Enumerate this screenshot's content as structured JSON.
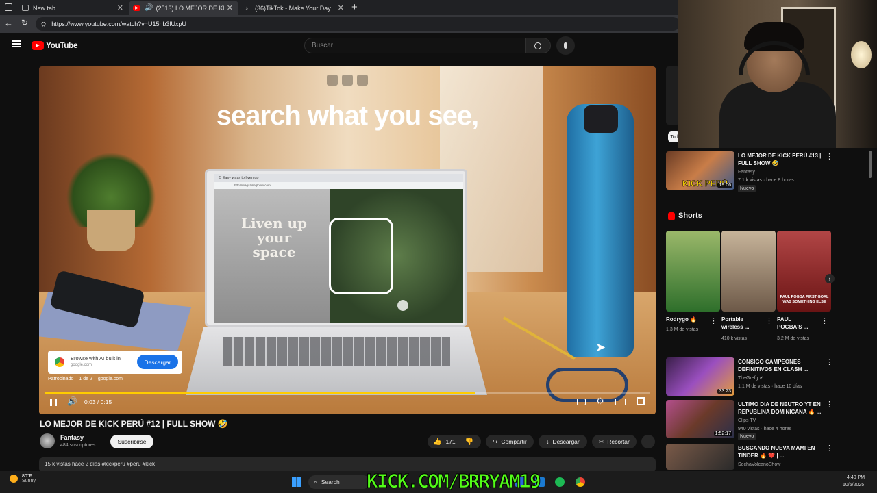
{
  "browser": {
    "tabs": [
      {
        "title": "New tab"
      },
      {
        "title": "(2513) LO MEJOR DE KICK PE"
      },
      {
        "title": "(36)TikTok - Make Your Day"
      }
    ],
    "url": "https://www.youtube.com/watch?v=U15hb3lUxpU"
  },
  "youtube": {
    "logo_text": "YouTube",
    "search_placeholder": "Buscar"
  },
  "video": {
    "headline": "search what you see,",
    "laptop_tab": "5 Easy ways to liven up",
    "laptop_url": "http://magazinegloom.com",
    "laptop_text": "Liven up your space",
    "ad": {
      "text": "Browse with AI built in",
      "domain": "google.com",
      "button": "Descargar",
      "sponsor_line": "Patrocinado",
      "sponsor_count": "1 de 2",
      "sponsor_domain": "google.com"
    },
    "time": "0:03 / 0:15",
    "progress": 0.71
  },
  "meta": {
    "title": "LO MEJOR DE KICK PERÚ #12 | FULL SHOW 🤣",
    "channel": "Fantasy",
    "subscribers": "484 suscriptores",
    "subscribe": "Suscribirse",
    "likes": "171",
    "share": "Compartir",
    "download": "Descargar",
    "clip": "Recortar",
    "description": "15 k vistas  hace 2 días  #kickperu #peru #kick"
  },
  "sidebar": {
    "chip": "Tod",
    "video1": {
      "title": "LO MEJOR DE KICK PERÚ #13 | FULL SHOW 🤣",
      "channel": "Fantasy",
      "stats": "7.1 k vistas · hace 8 horas",
      "badge": "Nuevo",
      "duration": "19:06",
      "thumb_text": "KICK PERÚ"
    },
    "shorts_header": "Shorts",
    "shorts": [
      {
        "title": "Rodrygo 🔥",
        "views": "1.3 M de vistas"
      },
      {
        "title": "Portable wireless ...",
        "views": "410 k vistas"
      },
      {
        "title": "PAUL POGBA'S ...",
        "views": "3.2 M de vistas",
        "thumb_text": "PAUL POGBA FIRST GOAL WAS SOMETHING ELSE"
      }
    ],
    "videos": [
      {
        "title": "CONSIGO CAMPEONES DEFINITIVOS EN CLASH ...",
        "channel": "TheGrefg ✔",
        "stats": "1.1 M de vistas · hace 10 días",
        "duration": "33:23"
      },
      {
        "title": "ULTIMO DIA DE NEUTRO YT EN REPUBLINA DOMINICANA 🔥 ...",
        "channel": "Clips TV",
        "stats": "940 vistas · hace 4 horas",
        "badge": "Nuevo",
        "duration": "1:52:17"
      },
      {
        "title": "BUSCANDO NUEVA MAMI EN TINDER 🔥 ❤️ | ...",
        "channel": "SechaVolcanoShow",
        "stats": ""
      }
    ]
  },
  "taskbar": {
    "weather_temp": "80°F",
    "weather_cond": "Sunny",
    "search": "Search",
    "time": "4:40 PM",
    "date": "10/5/2025",
    "overlay": "KICK.COM/BRRYAM19"
  },
  "colors": {
    "accent": "#ff0000",
    "progress": "#ffcc00",
    "kick": "#53fc18",
    "ad_button": "#1a73e8"
  }
}
